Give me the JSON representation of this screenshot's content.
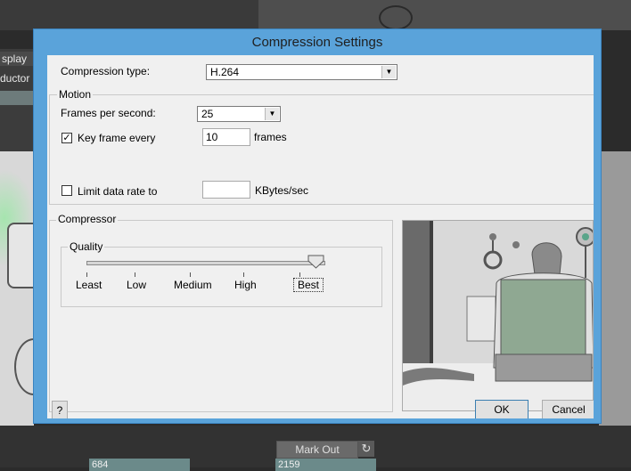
{
  "background": {
    "left_tab_1": "splay",
    "left_tab_2": "ductor",
    "mark_out_label": "Mark Out",
    "refresh_icon": "↻",
    "timecode_in": "684",
    "timecode_out": "2159"
  },
  "dialog": {
    "title": "Compression Settings",
    "compression_type_label": "Compression type:",
    "compression_type_value": "H.264",
    "motion": {
      "group_label": "Motion",
      "fps_label": "Frames per second:",
      "fps_value": "25",
      "keyframe_label": "Key frame every",
      "keyframe_checked": true,
      "keyframe_value": "10",
      "keyframe_unit": "frames",
      "limit_label": "Limit data rate to",
      "limit_checked": false,
      "limit_value": "",
      "limit_unit": "KBytes/sec"
    },
    "compressor": {
      "group_label": "Compressor",
      "quality_label": "Quality",
      "quality_levels": [
        "Least",
        "Low",
        "Medium",
        "High",
        "Best"
      ],
      "quality_selected": "Best",
      "quality_level_index": 4
    },
    "buttons": {
      "help": "?",
      "ok": "OK",
      "cancel": "Cancel"
    }
  },
  "colors": {
    "dialog_frame": "#5aa3da",
    "dialog_client": "#f0f0f0",
    "preview_sweater": "#8fa892"
  }
}
